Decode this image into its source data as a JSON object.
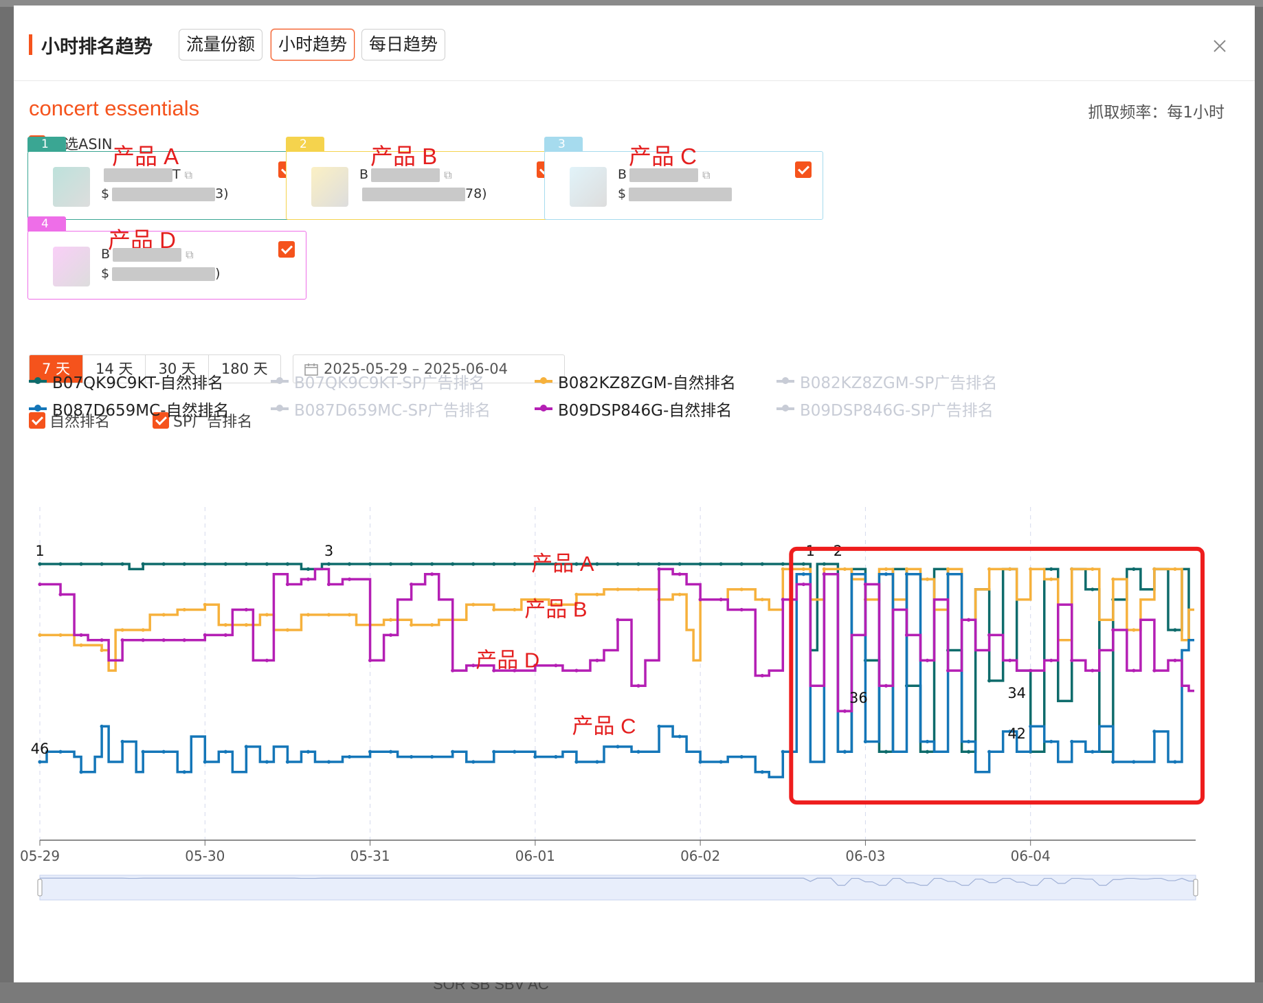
{
  "backdrop_text": "SOR SB SBV AC",
  "header": {
    "title": "小时排名趋势",
    "tabs": [
      {
        "label": "流量份额"
      },
      {
        "label": "小时趋势"
      },
      {
        "label": "每日趋势"
      }
    ],
    "active_tab": "小时趋势",
    "close_icon": "close-icon"
  },
  "keyword": "concert essentials",
  "frequency": "抓取频率：每1小时",
  "select_all": "全选ASIN",
  "colors": {
    "accent": "#f5531c",
    "annotation_red": "#e41f1f",
    "B07QK9C9KT": "#0e6b6b",
    "B082KZ8ZGM": "#f6b13c",
    "B087D659MC": "#1476b8",
    "B09DSP846G": "#b41fb4",
    "disabled": "#c8ccd6"
  },
  "products": [
    {
      "num": "1",
      "label": "产品 A",
      "asin_prefix": "",
      "asin_tail": "T",
      "price_prefix": "$",
      "price_tail": "3)",
      "color": "#3aa693"
    },
    {
      "num": "2",
      "label": "产品 B",
      "asin_prefix": "B",
      "asin_tail": "",
      "price_prefix": "",
      "price_tail": "78)",
      "color": "#f5d34d"
    },
    {
      "num": "3",
      "label": "产品 C",
      "asin_prefix": "B",
      "asin_tail": "",
      "price_prefix": "$",
      "price_tail": "",
      "color": "#a6dbee"
    },
    {
      "num": "4",
      "label": "产品 D",
      "asin_prefix": "B",
      "asin_tail": "",
      "price_prefix": "$",
      "price_tail": ")",
      "color": "#ee6ee8"
    }
  ],
  "ranges": [
    "7 天",
    "14 天",
    "30 天",
    "180 天"
  ],
  "active_range": "7 天",
  "date_range": "2025-05-29  –  2025-06-04",
  "rank_types": [
    "自然排名",
    "SP广告排名"
  ],
  "legend": [
    {
      "label": "B07QK9C9KT-自然排名",
      "enabled": true,
      "color": "#0e6b6b"
    },
    {
      "label": "B07QK9C9KT-SP广告排名",
      "enabled": false,
      "color": "#c8ccd6"
    },
    {
      "label": "B082KZ8ZGM-自然排名",
      "enabled": true,
      "color": "#f6b13c"
    },
    {
      "label": "B082KZ8ZGM-SP广告排名",
      "enabled": false,
      "color": "#c8ccd6"
    },
    {
      "label": "B087D659MC-自然排名",
      "enabled": true,
      "color": "#1476b8"
    },
    {
      "label": "B087D659MC-SP广告排名",
      "enabled": false,
      "color": "#c8ccd6"
    },
    {
      "label": "B09DSP846G-自然排名",
      "enabled": true,
      "color": "#b41fb4"
    },
    {
      "label": "B09DSP846G-SP广告排名",
      "enabled": false,
      "color": "#c8ccd6"
    }
  ],
  "chart_data": {
    "type": "line",
    "x_ticks": [
      "05-29",
      "05-30",
      "05-31",
      "06-01",
      "06-02",
      "06-03",
      "06-04"
    ],
    "ylim": [
      1,
      50
    ],
    "y_inverted": true,
    "hours": 168,
    "series": [
      {
        "name": "B07QK9C9KT-自然排名",
        "color": "#0e6b6b",
        "keyframes": [
          [
            0,
            1
          ],
          [
            12,
            1
          ],
          [
            13,
            2
          ],
          [
            15,
            1
          ],
          [
            37,
            1
          ],
          [
            38,
            2
          ],
          [
            40,
            2
          ],
          [
            41,
            1
          ],
          [
            108,
            1
          ],
          [
            112,
            18
          ],
          [
            113,
            1
          ],
          [
            116,
            38
          ],
          [
            118,
            2
          ],
          [
            120,
            20
          ],
          [
            122,
            38
          ],
          [
            124,
            2
          ],
          [
            126,
            25
          ],
          [
            128,
            38
          ],
          [
            130,
            2
          ],
          [
            132,
            18
          ],
          [
            134,
            38
          ],
          [
            136,
            6
          ],
          [
            138,
            24
          ],
          [
            140,
            2
          ],
          [
            142,
            22
          ],
          [
            144,
            38
          ],
          [
            146,
            2
          ],
          [
            148,
            28
          ],
          [
            150,
            2
          ],
          [
            152,
            6
          ],
          [
            154,
            38
          ],
          [
            156,
            8
          ],
          [
            158,
            2
          ],
          [
            160,
            6
          ],
          [
            162,
            2
          ],
          [
            164,
            14
          ],
          [
            166,
            2
          ],
          [
            167,
            16
          ]
        ]
      },
      {
        "name": "B082KZ8ZGM-自然排名",
        "color": "#f6b13c",
        "keyframes": [
          [
            0,
            15
          ],
          [
            5,
            17
          ],
          [
            8,
            17
          ],
          [
            9,
            18
          ],
          [
            10,
            22
          ],
          [
            11,
            14
          ],
          [
            14,
            14
          ],
          [
            16,
            11
          ],
          [
            20,
            10
          ],
          [
            24,
            9
          ],
          [
            26,
            13
          ],
          [
            30,
            13
          ],
          [
            32,
            11
          ],
          [
            34,
            14
          ],
          [
            38,
            11
          ],
          [
            42,
            11
          ],
          [
            46,
            13
          ],
          [
            50,
            12
          ],
          [
            54,
            13
          ],
          [
            58,
            12
          ],
          [
            62,
            9
          ],
          [
            66,
            10
          ],
          [
            70,
            8
          ],
          [
            74,
            9
          ],
          [
            78,
            7
          ],
          [
            82,
            6
          ],
          [
            86,
            6
          ],
          [
            90,
            8
          ],
          [
            92,
            7
          ],
          [
            94,
            14
          ],
          [
            95,
            20
          ],
          [
            96,
            8
          ],
          [
            100,
            6
          ],
          [
            104,
            8
          ],
          [
            106,
            10
          ],
          [
            108,
            2
          ],
          [
            110,
            2
          ],
          [
            112,
            8
          ],
          [
            114,
            2
          ],
          [
            116,
            2
          ],
          [
            118,
            4
          ],
          [
            120,
            8
          ],
          [
            122,
            2
          ],
          [
            124,
            8
          ],
          [
            126,
            2
          ],
          [
            128,
            4
          ],
          [
            130,
            10
          ],
          [
            132,
            2
          ],
          [
            134,
            12
          ],
          [
            136,
            6
          ],
          [
            138,
            2
          ],
          [
            140,
            2
          ],
          [
            142,
            8
          ],
          [
            144,
            2
          ],
          [
            146,
            4
          ],
          [
            148,
            16
          ],
          [
            150,
            2
          ],
          [
            152,
            2
          ],
          [
            154,
            12
          ],
          [
            156,
            4
          ],
          [
            158,
            14
          ],
          [
            160,
            8
          ],
          [
            162,
            2
          ],
          [
            164,
            2
          ],
          [
            166,
            16
          ],
          [
            167,
            10
          ]
        ]
      },
      {
        "name": "B087D659MC-自然排名",
        "color": "#1476b8",
        "keyframes": [
          [
            0,
            40
          ],
          [
            1,
            38
          ],
          [
            3,
            38
          ],
          [
            5,
            39
          ],
          [
            6,
            42
          ],
          [
            8,
            39
          ],
          [
            9,
            33
          ],
          [
            10,
            40
          ],
          [
            12,
            36
          ],
          [
            14,
            42
          ],
          [
            15,
            38
          ],
          [
            18,
            38
          ],
          [
            20,
            42
          ],
          [
            22,
            35
          ],
          [
            24,
            40
          ],
          [
            26,
            38
          ],
          [
            28,
            42
          ],
          [
            30,
            37
          ],
          [
            32,
            40
          ],
          [
            34,
            37
          ],
          [
            36,
            40
          ],
          [
            38,
            38
          ],
          [
            40,
            40
          ],
          [
            44,
            39
          ],
          [
            48,
            38
          ],
          [
            52,
            39
          ],
          [
            56,
            39
          ],
          [
            60,
            38
          ],
          [
            62,
            40
          ],
          [
            66,
            38
          ],
          [
            70,
            38
          ],
          [
            72,
            39
          ],
          [
            76,
            38
          ],
          [
            78,
            40
          ],
          [
            82,
            37
          ],
          [
            86,
            38
          ],
          [
            90,
            33
          ],
          [
            92,
            35
          ],
          [
            94,
            38
          ],
          [
            96,
            40
          ],
          [
            100,
            39
          ],
          [
            104,
            42
          ],
          [
            106,
            43
          ],
          [
            108,
            38
          ],
          [
            110,
            3
          ],
          [
            112,
            40
          ],
          [
            114,
            3
          ],
          [
            116,
            38
          ],
          [
            118,
            3
          ],
          [
            120,
            36
          ],
          [
            122,
            3
          ],
          [
            124,
            38
          ],
          [
            126,
            3
          ],
          [
            128,
            36
          ],
          [
            130,
            38
          ],
          [
            132,
            3
          ],
          [
            134,
            36
          ],
          [
            136,
            42
          ],
          [
            138,
            38
          ],
          [
            140,
            34
          ],
          [
            142,
            38
          ],
          [
            144,
            33
          ],
          [
            146,
            36
          ],
          [
            148,
            40
          ],
          [
            150,
            36
          ],
          [
            152,
            38
          ],
          [
            154,
            33
          ],
          [
            156,
            40
          ],
          [
            158,
            40
          ],
          [
            160,
            40
          ],
          [
            162,
            34
          ],
          [
            164,
            40
          ],
          [
            166,
            18
          ],
          [
            167,
            16
          ]
        ]
      },
      {
        "name": "B09DSP846G-自然排名",
        "color": "#b41fb4",
        "keyframes": [
          [
            0,
            5
          ],
          [
            3,
            7
          ],
          [
            5,
            15
          ],
          [
            7,
            16
          ],
          [
            10,
            20
          ],
          [
            12,
            16
          ],
          [
            16,
            16
          ],
          [
            20,
            16
          ],
          [
            24,
            15
          ],
          [
            28,
            10
          ],
          [
            31,
            20
          ],
          [
            32,
            20
          ],
          [
            34,
            3
          ],
          [
            36,
            5
          ],
          [
            38,
            4
          ],
          [
            40,
            2
          ],
          [
            42,
            5
          ],
          [
            44,
            4
          ],
          [
            46,
            4
          ],
          [
            48,
            20
          ],
          [
            50,
            15
          ],
          [
            52,
            8
          ],
          [
            54,
            5
          ],
          [
            56,
            3
          ],
          [
            58,
            8
          ],
          [
            60,
            22
          ],
          [
            62,
            21
          ],
          [
            66,
            22
          ],
          [
            70,
            22
          ],
          [
            72,
            21
          ],
          [
            76,
            22
          ],
          [
            80,
            20
          ],
          [
            82,
            18
          ],
          [
            84,
            12
          ],
          [
            86,
            25
          ],
          [
            88,
            20
          ],
          [
            90,
            2
          ],
          [
            92,
            3
          ],
          [
            94,
            5
          ],
          [
            96,
            8
          ],
          [
            100,
            10
          ],
          [
            104,
            23
          ],
          [
            106,
            22
          ],
          [
            108,
            8
          ],
          [
            110,
            5
          ],
          [
            112,
            25
          ],
          [
            114,
            3
          ],
          [
            116,
            30
          ],
          [
            118,
            15
          ],
          [
            120,
            5
          ],
          [
            122,
            25
          ],
          [
            124,
            10
          ],
          [
            126,
            15
          ],
          [
            128,
            20
          ],
          [
            130,
            8
          ],
          [
            132,
            22
          ],
          [
            134,
            12
          ],
          [
            136,
            18
          ],
          [
            138,
            15
          ],
          [
            140,
            20
          ],
          [
            142,
            22
          ],
          [
            144,
            22
          ],
          [
            146,
            20
          ],
          [
            148,
            9
          ],
          [
            150,
            20
          ],
          [
            152,
            22
          ],
          [
            154,
            18
          ],
          [
            156,
            14
          ],
          [
            158,
            22
          ],
          [
            160,
            12
          ],
          [
            162,
            22
          ],
          [
            164,
            20
          ],
          [
            166,
            25
          ],
          [
            167,
            26
          ]
        ]
      }
    ],
    "point_labels": [
      {
        "text": "1",
        "x": 0,
        "y": 1
      },
      {
        "text": "46",
        "x": 0,
        "y": 40
      },
      {
        "text": "3",
        "x": 42,
        "y": 1
      },
      {
        "text": "1",
        "x": 112,
        "y": 1
      },
      {
        "text": "2",
        "x": 116,
        "y": 1
      },
      {
        "text": "36",
        "x": 119,
        "y": 30
      },
      {
        "text": "34",
        "x": 142,
        "y": 29
      },
      {
        "text": "42",
        "x": 142,
        "y": 37
      }
    ],
    "annotations": [
      {
        "text": "产品 A",
        "x": 76,
        "y": 1
      },
      {
        "text": "产品 B",
        "x": 75,
        "y": 10
      },
      {
        "text": "产品 D",
        "x": 68,
        "y": 20
      },
      {
        "text": "产品 C",
        "x": 82,
        "y": 33
      }
    ],
    "highlight_box": {
      "x_from": 110,
      "x_to": 169,
      "y_from": -2,
      "y_to": 48
    }
  }
}
